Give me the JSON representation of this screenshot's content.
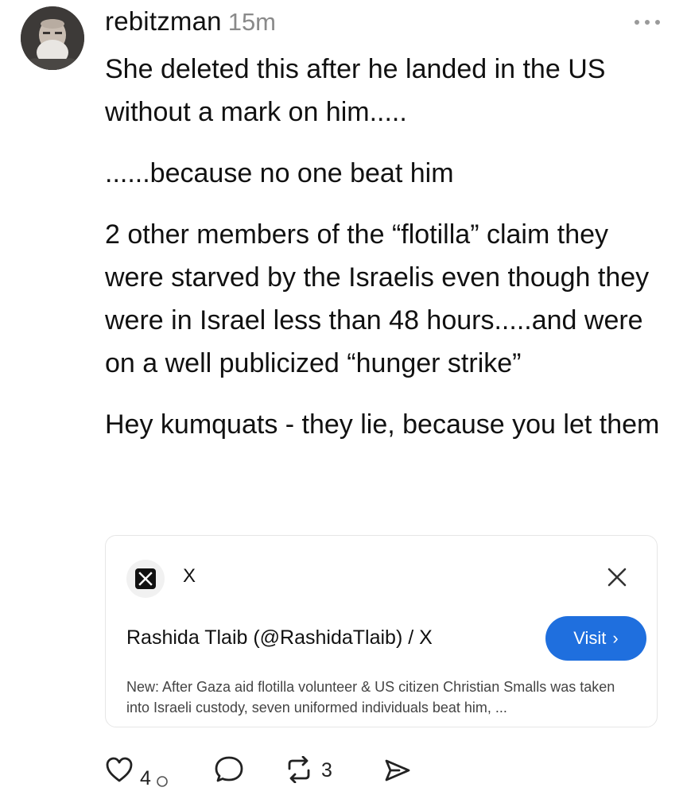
{
  "post": {
    "username": "rebitzman",
    "time": "15m",
    "paragraphs": [
      "She deleted this after he landed in the US without a mark on him.....",
      "......because no one beat him",
      "2 other members of the “flotilla” claim they were starved by the Israelis even though they were in Israel less than 48 hours.....and were on a well publicized “hunger strike”",
      "Hey kumquats - they lie, because you let them"
    ]
  },
  "link_card": {
    "site_name": "X",
    "site_logo_letter": "X",
    "title": "Rashida Tlaib (@RashidaTlaib) / X",
    "visit_label": "Visit",
    "visit_chevron": "›",
    "description": "New: After Gaza aid flotilla volunteer & US citizen Christian Smalls was taken into Israeli custody, seven uniformed individuals beat him, ..."
  },
  "actions": {
    "like_count": "4",
    "repost_count": "3"
  },
  "colors": {
    "accent": "#1f6fde",
    "text": "#111111",
    "muted": "#8a8a8a",
    "card_border": "#e6e6e6"
  },
  "icons": [
    "avatar",
    "more-icon",
    "x-logo-icon",
    "close-icon",
    "heart-icon",
    "comment-icon",
    "repost-icon",
    "share-icon"
  ]
}
